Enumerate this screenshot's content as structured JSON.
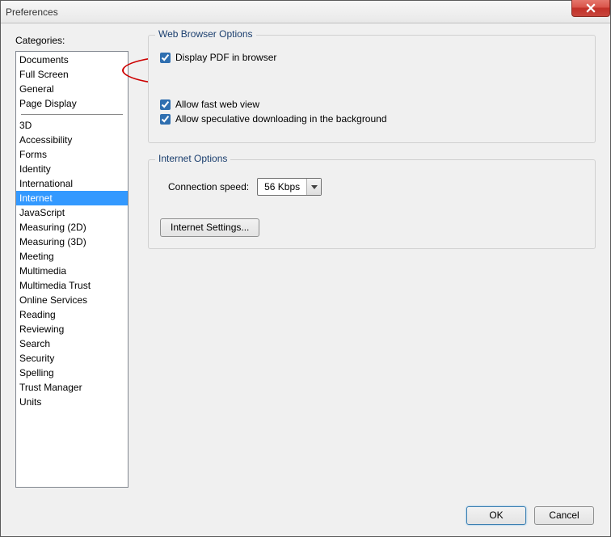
{
  "window": {
    "title": "Preferences"
  },
  "categories_label": "Categories:",
  "categories_top": [
    "Documents",
    "Full Screen",
    "General",
    "Page Display"
  ],
  "categories_bottom": [
    "3D",
    "Accessibility",
    "Forms",
    "Identity",
    "International",
    "Internet",
    "JavaScript",
    "Measuring (2D)",
    "Measuring (3D)",
    "Meeting",
    "Multimedia",
    "Multimedia Trust",
    "Online Services",
    "Reading",
    "Reviewing",
    "Search",
    "Security",
    "Spelling",
    "Trust Manager",
    "Units"
  ],
  "selected_category": "Internet",
  "web_browser": {
    "group_title": "Web Browser Options",
    "display_pdf": "Display PDF in browser",
    "fast_web": "Allow fast web view",
    "speculative": "Allow speculative downloading in the background"
  },
  "internet": {
    "group_title": "Internet Options",
    "conn_label": "Connection speed:",
    "conn_value": "56 Kbps",
    "settings_btn": "Internet Settings..."
  },
  "buttons": {
    "ok": "OK",
    "cancel": "Cancel"
  }
}
